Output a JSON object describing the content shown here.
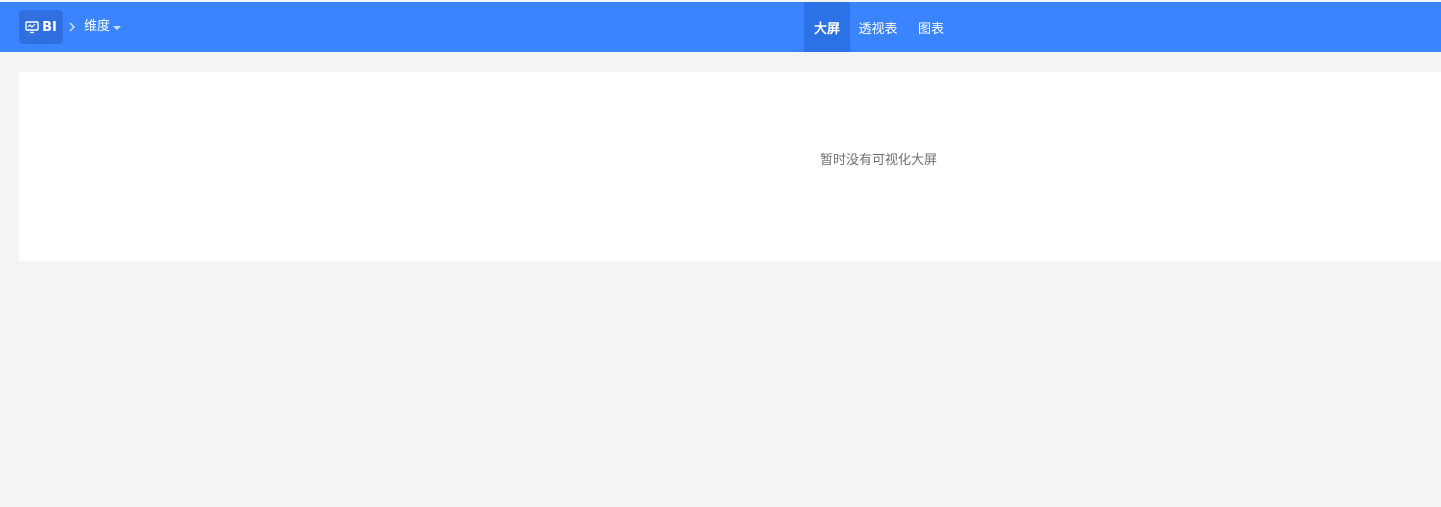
{
  "header": {
    "logo": {
      "icon": "monitor-icon",
      "text": "BI"
    },
    "breadcrumb": {
      "separator_icon": "chevron-right-icon",
      "current": "维度",
      "dropdown_icon": "caret-down-icon"
    },
    "tabs": [
      {
        "label": "大屏",
        "active": true
      },
      {
        "label": "透视表",
        "active": false
      },
      {
        "label": "图表",
        "active": false
      }
    ]
  },
  "main": {
    "empty_message": "暂时没有可视化大屏"
  },
  "colors": {
    "header_bg": "#3a85ff",
    "active_tab_bg": "#2c72e6",
    "page_bg": "#f3f4f6",
    "panel_bg": "#ffffff",
    "empty_text": "#6f6f73"
  }
}
